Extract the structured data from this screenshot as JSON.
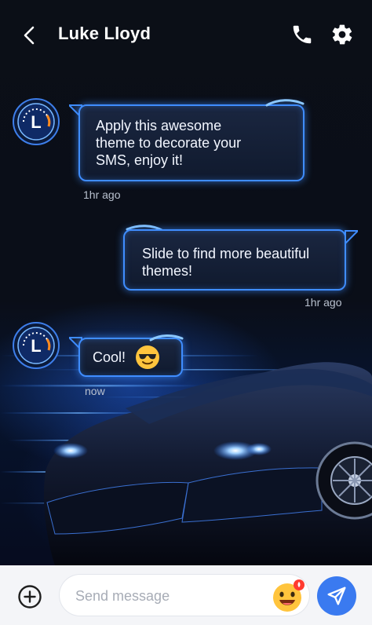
{
  "header": {
    "title": "Luke Lloyd"
  },
  "messages": [
    {
      "direction": "incoming",
      "text_lines": [
        "Apply this awesome",
        "theme to decorate your",
        "SMS, enjoy it!"
      ],
      "time": "1hr ago"
    },
    {
      "direction": "outgoing",
      "text_lines": [
        "Slide to find more beautiful",
        "themes!"
      ],
      "time": "1hr ago"
    },
    {
      "direction": "incoming",
      "text_lines": [
        "Cool!"
      ],
      "emoji": "smiling-face-with-sunglasses",
      "time": "now"
    }
  ],
  "avatar": {
    "letter": "L"
  },
  "composer": {
    "placeholder": "Send message",
    "value": ""
  },
  "colors": {
    "bubble_border": "#3f8dff",
    "send_button": "#3a7af0",
    "background": "#0b0f17"
  }
}
